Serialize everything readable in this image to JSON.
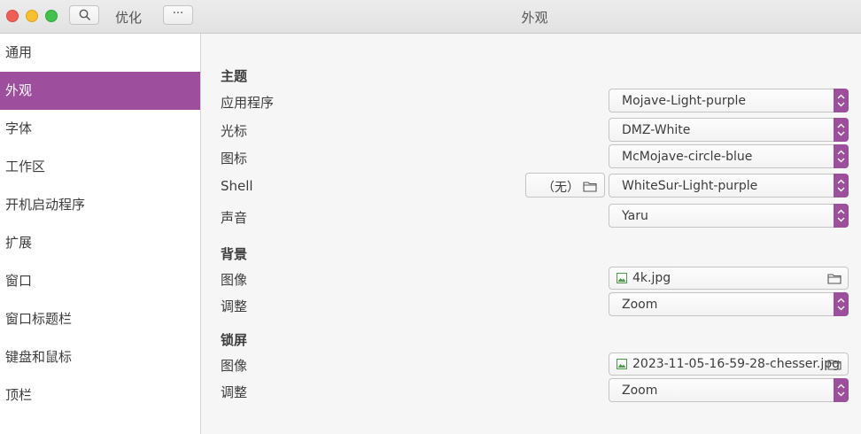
{
  "window": {
    "app_title": "优化",
    "title": "外观",
    "more_label": "···"
  },
  "sidebar": {
    "items": [
      "通用",
      "外观",
      "字体",
      "工作区",
      "开机启动程序",
      "扩展",
      "窗口",
      "窗口标题栏",
      "键盘和鼠标",
      "顶栏"
    ],
    "active": "外观"
  },
  "sections": {
    "themes": {
      "heading": "主题",
      "app_label": "应用程序",
      "app_value": "Mojave-Light-purple",
      "cursor_label": "光标",
      "cursor_value": "DMZ-White",
      "icons_label": "图标",
      "icons_value": "McMojave-circle-blue",
      "shell_label": "Shell",
      "shell_none": "（无）",
      "shell_value": "WhiteSur-Light-purple",
      "sound_label": "声音",
      "sound_value": "Yaru"
    },
    "background": {
      "heading": "背景",
      "image_label": "图像",
      "image_value": "4k.jpg",
      "adjust_label": "调整",
      "adjust_value": "Zoom"
    },
    "lockscreen": {
      "heading": "锁屏",
      "image_label": "图像",
      "image_value": "2023-11-05-16-59-28-chesser.jpg",
      "adjust_label": "调整",
      "adjust_value": "Zoom"
    }
  },
  "colors": {
    "accent": "#9d4f9e"
  }
}
